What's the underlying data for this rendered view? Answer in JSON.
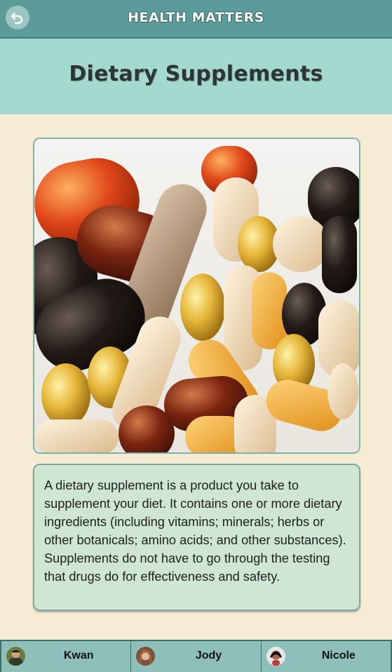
{
  "header": {
    "app_title": "HEALTH MATTERS",
    "back_icon": "undo-arrow-icon"
  },
  "page": {
    "title": "Dietary Supplements",
    "image_subject": "pills-and-capsules",
    "description": "A dietary supplement is a product you take to supplement your diet. It contains one or more dietary ingredients (including vitamins; minerals; herbs or other botanicals; amino acids; and other substances). Supplements do not have to go through the testing that drugs do for effectiveness and safety."
  },
  "users": [
    {
      "name": "Kwan",
      "avatar": "avatar-kwan"
    },
    {
      "name": "Jody",
      "avatar": "avatar-jody"
    },
    {
      "name": "Nicole",
      "avatar": "avatar-nicole"
    }
  ],
  "colors": {
    "topbar": "#5b9c9b",
    "header_band": "#a4d9d0",
    "background": "#f6ecd3",
    "text_card": "#cfe6d3",
    "bottom_bar": "#8ebfba"
  }
}
